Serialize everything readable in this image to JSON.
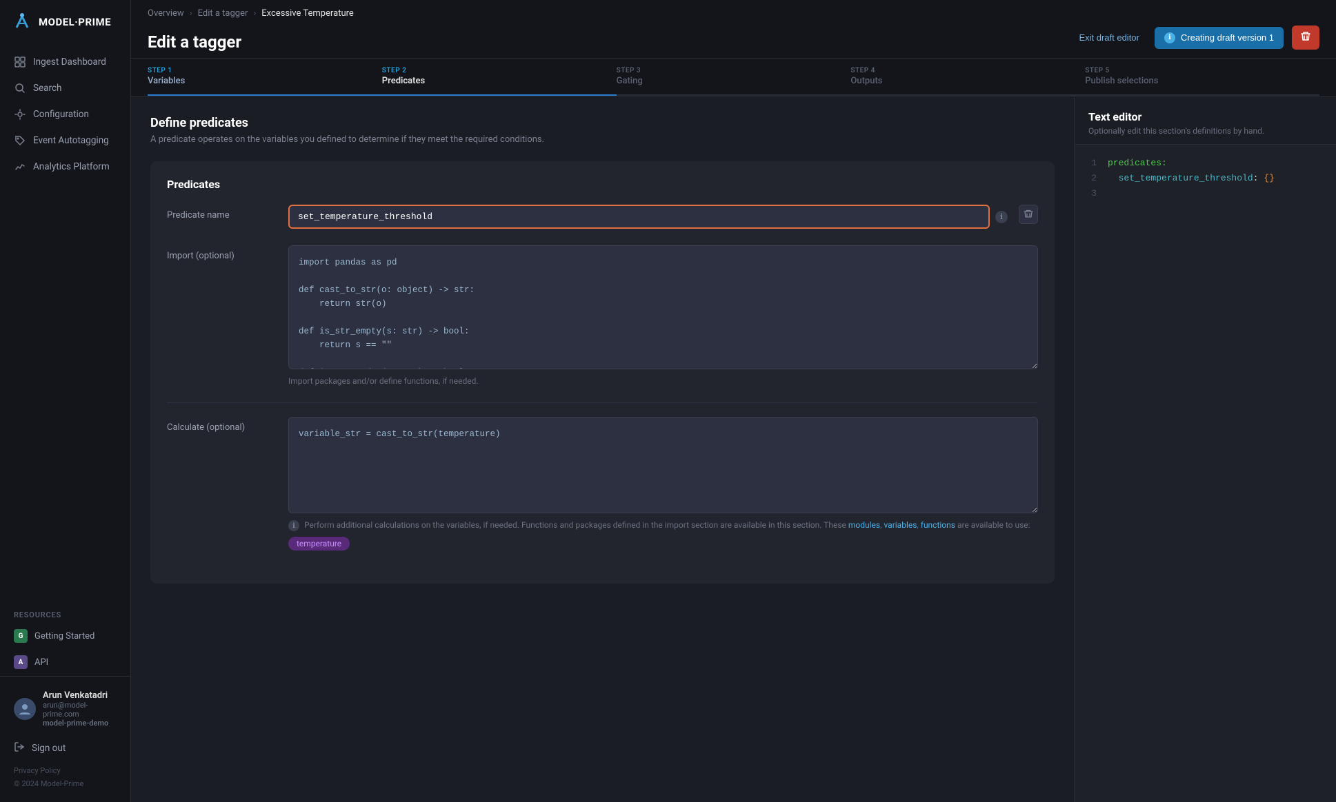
{
  "sidebar": {
    "logo_text": "MODEL·PRIME",
    "nav_items": [
      {
        "id": "ingest-dashboard",
        "label": "Ingest Dashboard",
        "icon": "dashboard-icon"
      },
      {
        "id": "search",
        "label": "Search",
        "icon": "search-icon"
      },
      {
        "id": "configuration",
        "label": "Configuration",
        "icon": "config-icon"
      },
      {
        "id": "event-autotagging",
        "label": "Event Autotagging",
        "icon": "tag-icon"
      },
      {
        "id": "analytics-platform",
        "label": "Analytics Platform",
        "icon": "analytics-icon"
      }
    ],
    "resources_label": "Resources",
    "resource_items": [
      {
        "id": "getting-started",
        "label": "Getting Started",
        "badge": "G",
        "badge_type": "green"
      },
      {
        "id": "api",
        "label": "API",
        "badge": "A",
        "badge_type": "purple"
      }
    ],
    "user": {
      "name": "Arun Venkatadri",
      "email": "arun@model-prime.com",
      "org": "model-prime-demo"
    },
    "sign_out_label": "Sign out",
    "privacy_label": "Privacy Policy",
    "copyright": "© 2024 Model-Prime"
  },
  "header": {
    "breadcrumbs": [
      "Overview",
      "Edit a tagger",
      "Excessive Temperature"
    ],
    "page_title": "Edit a tagger",
    "exit_draft_label": "Exit draft editor",
    "creating_draft_label": "Creating draft version 1",
    "delete_tooltip": "Delete"
  },
  "steps": [
    {
      "id": "step1",
      "number": "STEP 1",
      "label": "Variables",
      "state": "done"
    },
    {
      "id": "step2",
      "number": "STEP 2",
      "label": "Predicates",
      "state": "active"
    },
    {
      "id": "step3",
      "number": "STEP 3",
      "label": "Gating",
      "state": "inactive"
    },
    {
      "id": "step4",
      "number": "STEP 4",
      "label": "Outputs",
      "state": "inactive"
    },
    {
      "id": "step5",
      "number": "STEP 5",
      "label": "Publish selections",
      "state": "inactive"
    }
  ],
  "main": {
    "section_title": "Define predicates",
    "section_desc": "A predicate operates on the variables you defined to determine if they meet the required conditions.",
    "predicates_title": "Predicates",
    "predicate_name_label": "Predicate name",
    "predicate_name_value": "set_temperature_threshold",
    "import_label": "Import (optional)",
    "import_code": "import pandas as pd\n\ndef cast_to_str(o: object) -> str:\n    return str(o)\n\ndef is_str_empty(s: str) -> bool:\n    return s == \"\"\n\ndef is_na_pandas(o: str) -> bool:\n    return pd.isna(o)",
    "import_hint": "Import packages and/or define functions, if needed.",
    "calculate_label": "Calculate (optional)",
    "calculate_code": "variable_str = cast_to_str(temperature)",
    "calculate_hint_prefix": "Perform additional calculations on the variables, if needed. Functions and packages defined in the import section are available in this section. These ",
    "calculate_hint_links": [
      "modules",
      "variables",
      "functions"
    ],
    "calculate_hint_suffix": " are available to use:",
    "available_tags": [
      "temperature"
    ]
  },
  "text_editor": {
    "title": "Text editor",
    "desc": "Optionally edit this section's definitions by hand.",
    "code_lines": [
      {
        "num": "1",
        "content": "predicates:"
      },
      {
        "num": "2",
        "content": "  set_temperature_threshold: {}"
      },
      {
        "num": "3",
        "content": ""
      }
    ]
  }
}
